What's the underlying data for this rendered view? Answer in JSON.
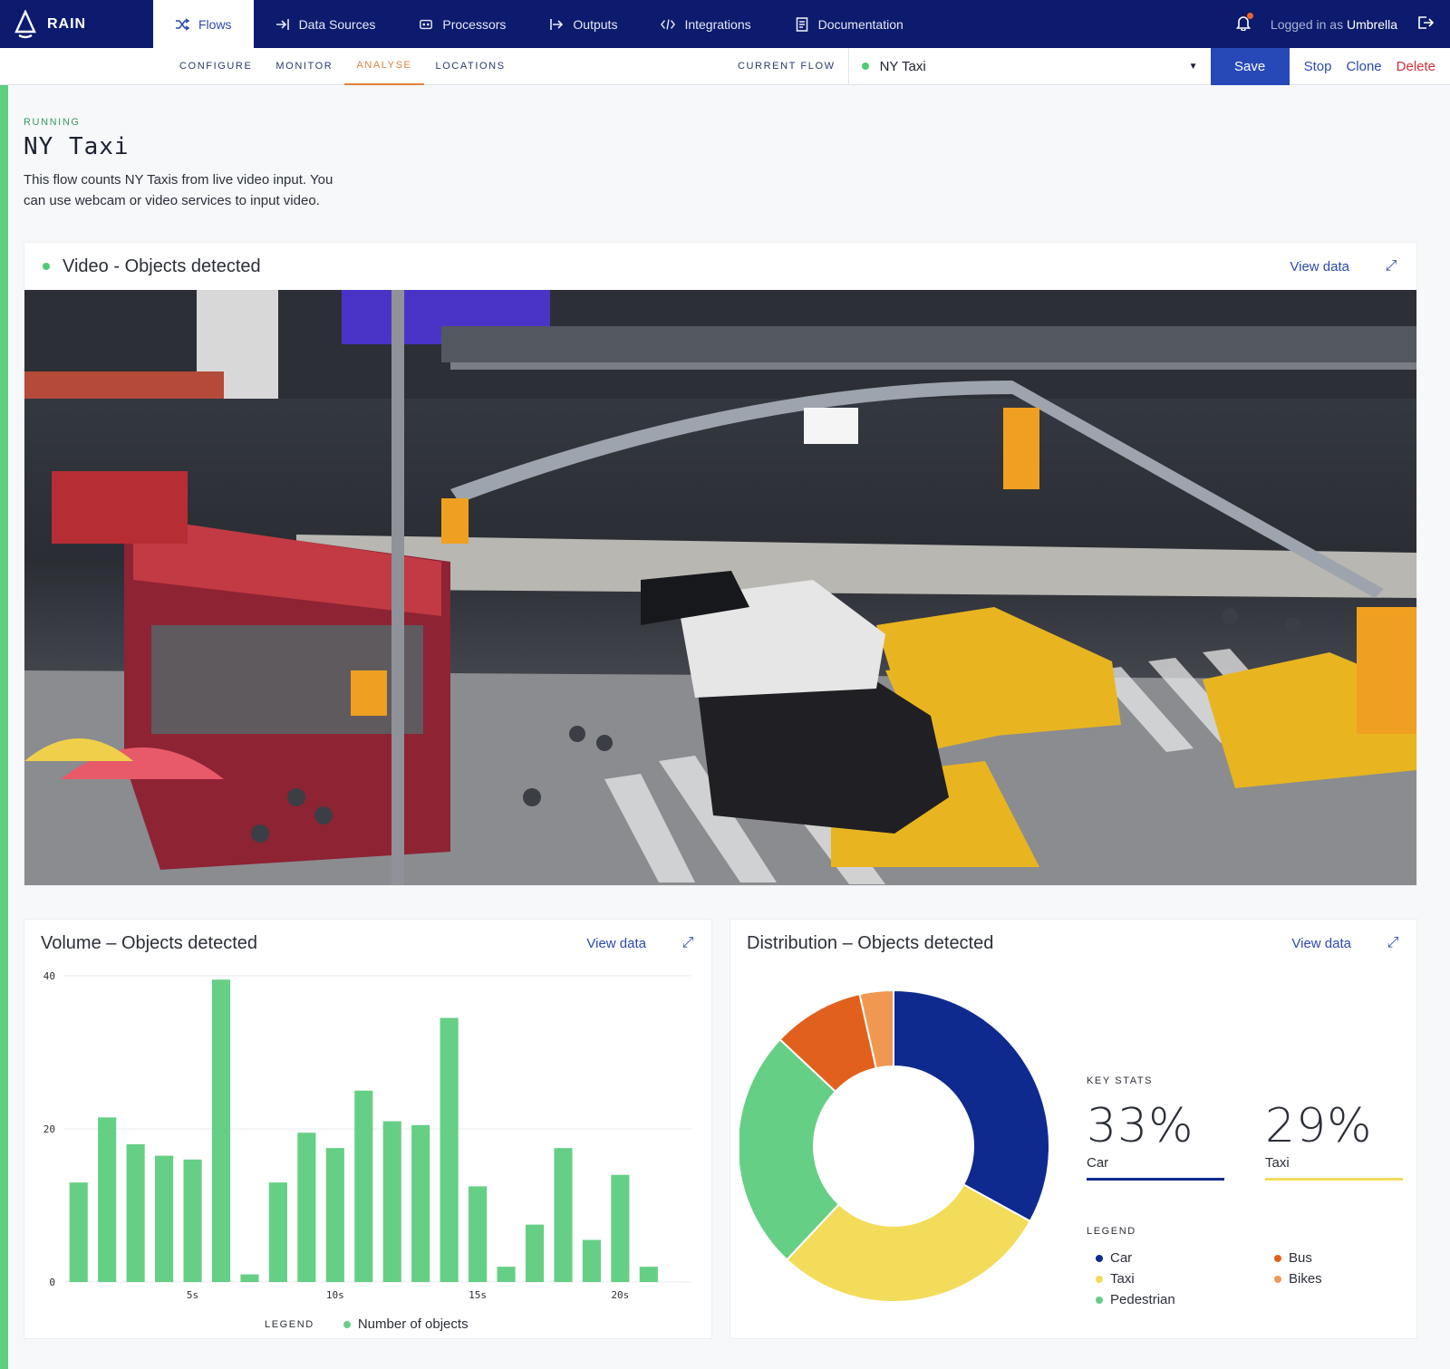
{
  "app": {
    "name": "RAIN"
  },
  "nav": [
    {
      "label": "Flows",
      "icon": "shuffle-icon",
      "active": true
    },
    {
      "label": "Data Sources",
      "icon": "arrow-in-icon"
    },
    {
      "label": "Processors",
      "icon": "processor-icon"
    },
    {
      "label": "Outputs",
      "icon": "arrow-out-icon"
    },
    {
      "label": "Integrations",
      "icon": "code-icon"
    },
    {
      "label": "Documentation",
      "icon": "document-icon"
    }
  ],
  "user": {
    "prefix": "Logged in as",
    "name": "Umbrella"
  },
  "subtabs": [
    {
      "label": "CONFIGURE"
    },
    {
      "label": "MONITOR"
    },
    {
      "label": "ANALYSE",
      "active": true
    },
    {
      "label": "LOCATIONS"
    }
  ],
  "current_flow": {
    "label": "CURRENT FLOW",
    "value": "NY Taxi"
  },
  "actions": {
    "save": "Save",
    "stop": "Stop",
    "clone": "Clone",
    "delete": "Delete"
  },
  "flow": {
    "status": "RUNNING",
    "title": "NY Taxi",
    "description": "This flow counts NY Taxis from live video input. You can use webcam or video services to input video."
  },
  "video_card": {
    "title": "Video - Objects detected",
    "view_data": "View data"
  },
  "volume_card": {
    "title": "Volume – Objects detected",
    "view_data": "View data",
    "legend_label": "LEGEND",
    "legend_item": "Number of objects"
  },
  "distribution_card": {
    "title": "Distribution – Objects detected",
    "view_data": "View data",
    "key_stats_label": "KEY STATS",
    "stats": [
      {
        "value": "33%",
        "label": "Car",
        "color": "#0f2a8f"
      },
      {
        "value": "29%",
        "label": "Taxi",
        "color": "#f3dc5a"
      }
    ],
    "legend_label": "LEGEND",
    "legend": [
      {
        "label": "Car",
        "color": "#0f2a8f"
      },
      {
        "label": "Taxi",
        "color": "#f3dc5a"
      },
      {
        "label": "Pedestrian",
        "color": "#66cf86"
      },
      {
        "label": "Bus",
        "color": "#e2601d"
      },
      {
        "label": "Bikes",
        "color": "#f09852"
      }
    ]
  },
  "chart_data": [
    {
      "type": "bar",
      "title": "Volume – Objects detected",
      "ylim": [
        0,
        40
      ],
      "yticks": [
        "0",
        "20",
        "40"
      ],
      "xticks": [
        "5s",
        "10s",
        "15s",
        "20s"
      ],
      "xtick_positions": [
        5,
        10,
        15,
        20
      ],
      "x": [
        1,
        2,
        3,
        4,
        5,
        6,
        7,
        8,
        9,
        10,
        11,
        12,
        13,
        14,
        15,
        16,
        17,
        18,
        19,
        20,
        21,
        22
      ],
      "series": [
        {
          "name": "Number of objects",
          "color": "#66cf86",
          "values": [
            13,
            21.5,
            18,
            16.5,
            16,
            39.5,
            1,
            13,
            19.5,
            17.5,
            25,
            21,
            20.5,
            34.5,
            12.5,
            2,
            7.5,
            17.5,
            5.5,
            14,
            2,
            0
          ]
        }
      ],
      "grid": true
    },
    {
      "type": "pie",
      "title": "Distribution – Objects detected",
      "donut": true,
      "slices": [
        {
          "label": "Car",
          "value": 33,
          "color": "#0f2a8f"
        },
        {
          "label": "Taxi",
          "value": 29,
          "color": "#f3dc5a"
        },
        {
          "label": "Pedestrian",
          "value": 25,
          "color": "#66cf86"
        },
        {
          "label": "Bus",
          "value": 9.5,
          "color": "#e2601d"
        },
        {
          "label": "Bikes",
          "value": 3.5,
          "color": "#f09852"
        }
      ]
    }
  ]
}
